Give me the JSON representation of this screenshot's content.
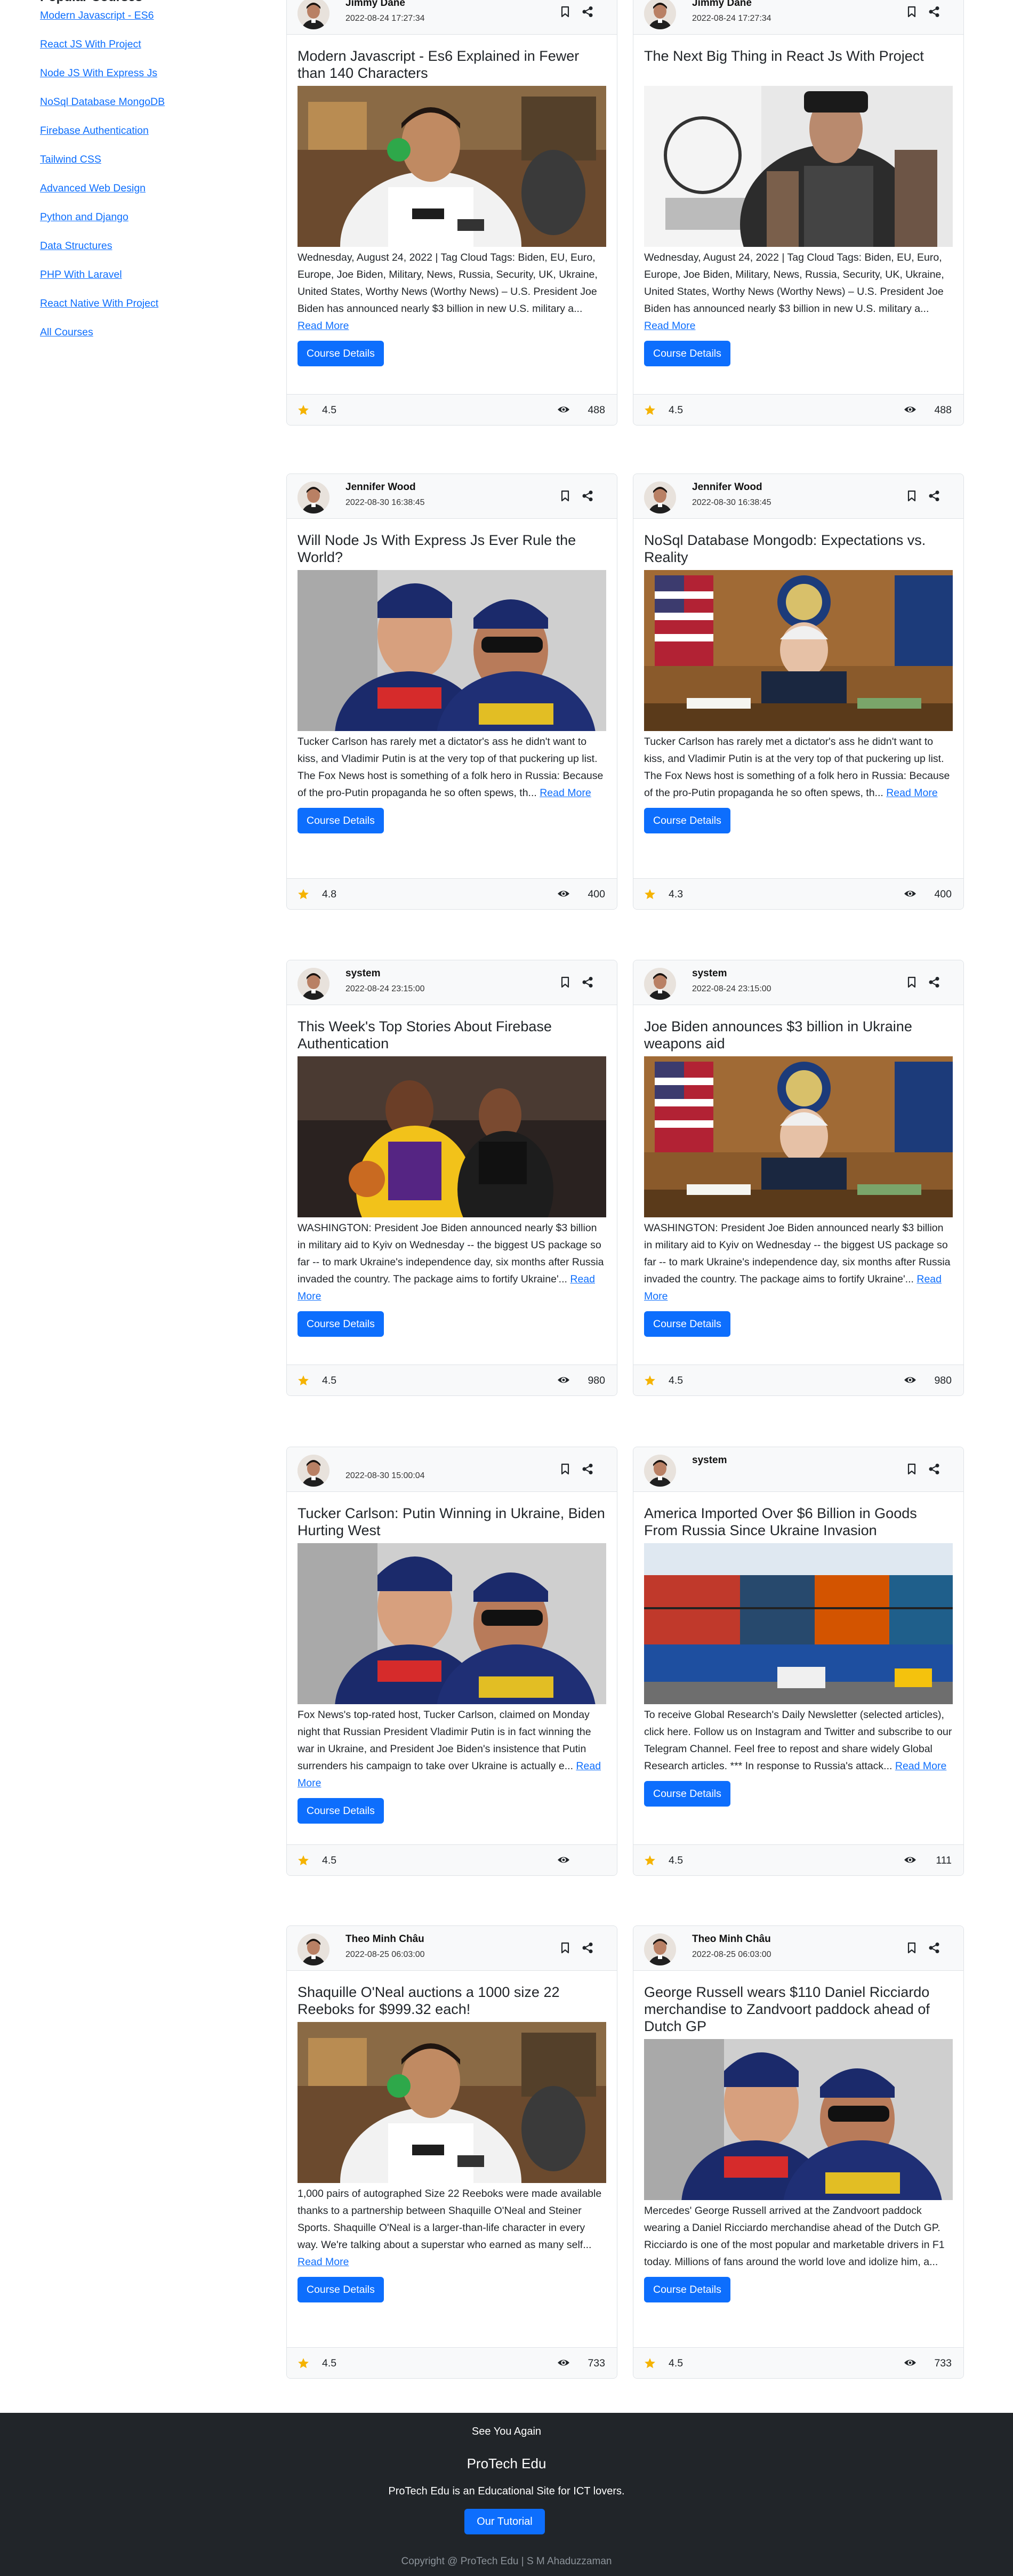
{
  "sidebar": {
    "heading": "Popular Courses",
    "links": [
      "Modern Javascript - ES6",
      "React JS With Project",
      "Node JS With Express Js",
      "NoSql Database MongoDB",
      "Firebase Authentication",
      "Tailwind CSS",
      "Advanced Web Design",
      "Python and Django",
      "Data Structures",
      "PHP With Laravel",
      "React Native With Project",
      "All Courses"
    ]
  },
  "cards": [
    {
      "author": "Jimmy Dane",
      "date": "2022-08-24 17:27:34",
      "title": "Modern Javascript - Es6 Explained in Fewer than 140 Characters",
      "excerpt": "Wednesday, August 24, 2022 | Tag Cloud Tags: Biden, EU, Euro, Europe, Joe Biden, Military, News, Russia, Security, UK, Ukraine, United States, Worthy News (Worthy News) – U.S. President Joe Biden has announced nearly $3 billion in new U.S. military a...",
      "read_more": "Read More",
      "button": "Course Details",
      "rating": "4.5",
      "views": "488",
      "image": "racing-driver"
    },
    {
      "author": "Jimmy Dane",
      "date": "2022-08-24 17:27:34",
      "title": "The Next Big Thing in React Js With Project",
      "excerpt": "Wednesday, August 24, 2022 | Tag Cloud Tags: Biden, EU, Euro, Europe, Joe Biden, Military, News, Russia, Security, UK, Ukraine, United States, Worthy News (Worthy News) – U.S. President Joe Biden has announced nearly $3 billion in new U.S. military a...",
      "read_more": "Read More",
      "button": "Course Details",
      "rating": "4.5",
      "views": "488",
      "image": "tattoo-man"
    },
    {
      "author": "Jennifer Wood",
      "date": "2022-08-30 16:38:45",
      "title": "Will Node Js With Express Js Ever Rule the World?",
      "excerpt": "Tucker Carlson has rarely met a dictator's ass he didn't want to kiss, and Vladimir Putin is at the very top of that puckering up list. The Fox News host is something of a folk hero in Russia: Because of the pro-Putin propaganda he so often spews, th...",
      "read_more": "Read More",
      "button": "Course Details",
      "rating": "4.8",
      "views": "400",
      "image": "two-drivers"
    },
    {
      "author": "Jennifer Wood",
      "date": "2022-08-30 16:38:45",
      "title": "NoSql Database Mongodb: Expectations vs. Reality",
      "excerpt": "Tucker Carlson has rarely met a dictator's ass he didn't want to kiss, and Vladimir Putin is at the very top of that puckering up list. The Fox News host is something of a folk hero in Russia: Because of the pro-Putin propaganda he so often spews, th...",
      "read_more": "Read More",
      "button": "Course Details",
      "rating": "4.3",
      "views": "400",
      "image": "president-desk"
    },
    {
      "author": "system",
      "date": "2022-08-24 23:15:00",
      "title": "This Week's Top Stories About Firebase Authentication",
      "excerpt": "WASHINGTON: President Joe Biden announced nearly $3 billion in military aid to Kyiv on Wednesday -- the biggest US package so far -- to mark Ukraine's independence day, six months after Russia invaded the country. The package aims to fortify Ukraine'...",
      "read_more": "Read More",
      "button": "Course Details",
      "rating": "4.5",
      "views": "980",
      "image": "basketball"
    },
    {
      "author": "system",
      "date": "2022-08-24 23:15:00",
      "title": "Joe Biden announces $3 billion in Ukraine weapons aid",
      "excerpt": "WASHINGTON: President Joe Biden announced nearly $3 billion in military aid to Kyiv on Wednesday -- the biggest US package so far -- to mark Ukraine's independence day, six months after Russia invaded the country. The package aims to fortify Ukraine'...",
      "read_more": "Read More",
      "button": "Course Details",
      "rating": "4.5",
      "views": "980",
      "image": "president-desk"
    },
    {
      "author": "",
      "date": "2022-08-30 15:00:04",
      "title": "Tucker Carlson: Putin Winning in Ukraine, Biden Hurting West",
      "excerpt": "Fox News's top-rated host, Tucker Carlson, claimed on Monday night that Russian President Vladimir Putin is in fact winning the war in Ukraine, and President Joe Biden's insistence that Putin surrenders his campaign to take over Ukraine is actually e...",
      "read_more": "Read More",
      "button": "Course Details",
      "rating": "4.5",
      "views": "",
      "image": "two-drivers"
    },
    {
      "author": "system",
      "date": "",
      "title": "America Imported Over $6 Billion in Goods From Russia Since Ukraine Invasion",
      "excerpt": "To receive Global Research's Daily Newsletter (selected articles), click here. Follow us on Instagram and Twitter and subscribe to our Telegram Channel. Feel free to repost and share widely Global Research articles. *** In response to Russia's attack...",
      "read_more": "Read More",
      "button": "Course Details",
      "rating": "4.5",
      "views": "111",
      "image": "containers"
    },
    {
      "author": "Theo Minh Châu",
      "date": "2022-08-25 06:03:00",
      "title": "Shaquille O'Neal auctions a 1000 size 22 Reeboks for $999.32 each!",
      "excerpt": "1,000 pairs of autographed Size 22 Reeboks were made available thanks to a partnership between Shaquille O'Neal and Steiner Sports. Shaquille O'Neal is a larger-than-life character in every way. We're talking about a superstar who earned as many self...",
      "read_more": "Read More",
      "button": "Course Details",
      "rating": "4.5",
      "views": "733",
      "image": "racing-driver"
    },
    {
      "author": "Theo Minh Châu",
      "date": "2022-08-25 06:03:00",
      "title": "George Russell wears $110 Daniel Ricciardo merchandise to Zandvoort paddock ahead of Dutch GP",
      "excerpt": "Mercedes' George Russell arrived at the Zandvoort paddock wearing a Daniel Ricciardo merchandise ahead of the Dutch GP. Ricciardo is one of the most popular and marketable drivers in F1 today. Millions of fans around the world love and idolize him, a...",
      "read_more": "Read More",
      "button": "Course Details",
      "rating": "4.5",
      "views": "733",
      "image": "two-drivers"
    }
  ],
  "footer": {
    "greeting": "See You Again",
    "brand": "ProTech Edu",
    "tagline": "ProTech Edu is an Educational Site for ICT lovers.",
    "button": "Our Tutorial",
    "copyright": "Copyright @ ProTech Edu | S M Ahaduzzaman"
  },
  "colors": {
    "primary": "#0d6efd",
    "footer_bg": "#212529",
    "star": "#f5b301"
  }
}
